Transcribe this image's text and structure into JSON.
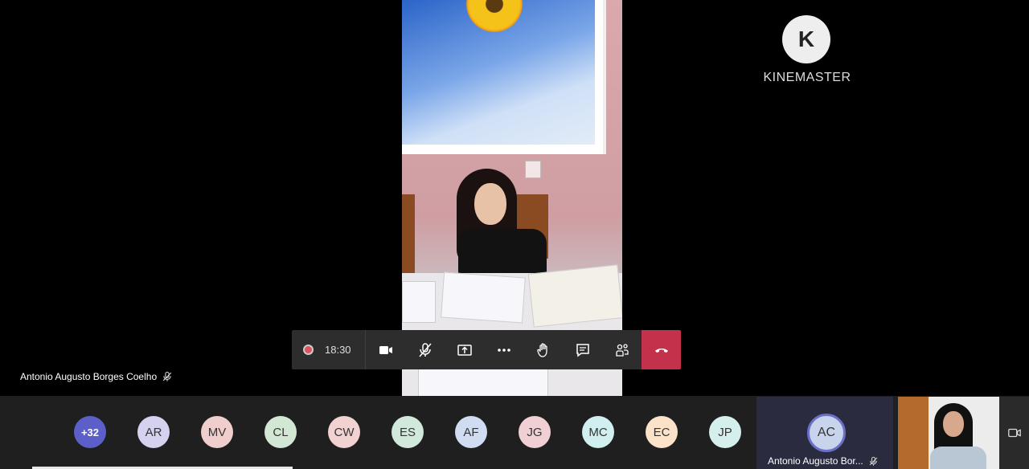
{
  "watermark": {
    "brand": "KINEMASTER",
    "logo_letter": "K"
  },
  "speaker": {
    "name": "Antonio Augusto Borges Coelho"
  },
  "toolbar": {
    "record_time": "18:30",
    "buttons": [
      "camera-icon",
      "mic-off-icon",
      "share-screen-icon",
      "more-icon",
      "raise-hand-icon",
      "chat-icon",
      "participants-icon",
      "hang-up-icon"
    ],
    "hangup_color": "#c4314b"
  },
  "participants": [
    {
      "initials": "+32",
      "color": "#5b5fc7"
    },
    {
      "initials": "AR",
      "color": "#d4d2ef"
    },
    {
      "initials": "MV",
      "color": "#f0cece"
    },
    {
      "initials": "CL",
      "color": "#d3e8d4"
    },
    {
      "initials": "CW",
      "color": "#f2d1d1"
    },
    {
      "initials": "ES",
      "color": "#d1e9db"
    },
    {
      "initials": "AF",
      "color": "#cfdcf2"
    },
    {
      "initials": "JG",
      "color": "#f0d0d4"
    },
    {
      "initials": "MC",
      "color": "#d2eff0"
    },
    {
      "initials": "EC",
      "color": "#fbe2c8"
    },
    {
      "initials": "JP",
      "color": "#d5f0ec"
    }
  ],
  "self": {
    "initials": "AC",
    "name": "Antonio Augusto Bor..."
  }
}
